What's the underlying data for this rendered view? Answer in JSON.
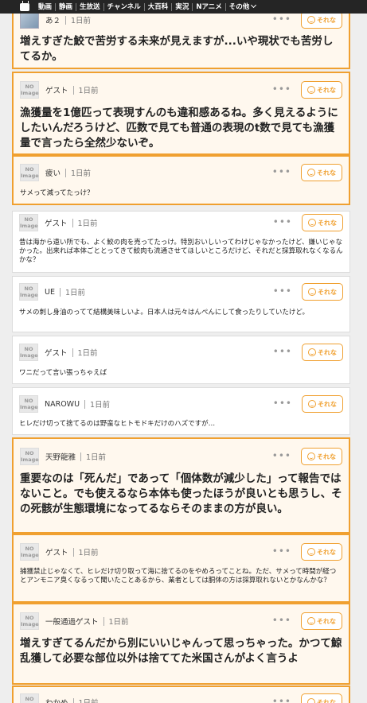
{
  "nav": {
    "items": [
      "動画",
      "静画",
      "生放送",
      "チャンネル",
      "大百科",
      "実況",
      "Nアニメ",
      "その他"
    ]
  },
  "avatar_text": "NO Image",
  "reaction_label": "それな",
  "comments": [
    {
      "user": "あ２",
      "time": "1日前",
      "text": "増えすぎた鮫で苦労する未来が見えますが...いや現状でも苦労してるか。"
    },
    {
      "user": "ゲスト",
      "time": "1日前",
      "text": "漁獲量を1億匹って表現すんのも違和感あるね。多く見えるようにしたいんだろうけど、匹数で見ても普通の表現のt数で見ても漁獲量で言ったら全然少ないぞ。"
    },
    {
      "user": "疲い",
      "time": "1日前",
      "text": "サメって減ってたっけ？"
    },
    {
      "user": "ゲスト",
      "time": "1日前",
      "text": "昔は海から遠い所でも、よく鮫の肉を売ってたっけ。特別おいしいってわけじゃなかったけど、嫌いじゃなかった。出来れば本体ごととってきて鮫肉も流通させてほしいところだけど、それだと採算取れなくなるんかな？"
    },
    {
      "user": "UE",
      "time": "1日前",
      "text": "サメの刺し身油のってて結構美味しいよ。日本人は元々はんぺんにして食ったりしていたけど。"
    },
    {
      "user": "ゲスト",
      "time": "1日前",
      "text": "ワニだって言い張っちゃえば"
    },
    {
      "user": "NAROWU",
      "time": "1日前",
      "text": "ヒレだけ切って捨てるのは野蛮なヒトモドキだけのハズですが…"
    },
    {
      "user": "天野龍雅",
      "time": "1日前",
      "text": "重要なのは「死んだ」であって「個体数が減少した」って報告ではないこと。でも使えるなら本体も使ったほうが良いとも思うし、その死骸が生態環境になってるならそのままの方が良い。"
    },
    {
      "user": "ゲスト",
      "time": "1日前",
      "text": "捕獲禁止じゃなくて、ヒレだけ切り取って海に捨てるのをやめろってことね。ただ、サメって時間が経つとアンモニア臭くなるって聞いたことあるから、業者としては胴体の方は採算取れないとかなんかな？"
    },
    {
      "user": "一般通過ゲスト",
      "time": "1日前",
      "text": "増えすぎてるんだから別にいいじゃんって思っちゃった。かつて鯨乱獲して必要な部位以外は捨ててた米国さんがよく言うよ"
    },
    {
      "user": "わかめ",
      "time": "1日前",
      "text": ""
    }
  ]
}
